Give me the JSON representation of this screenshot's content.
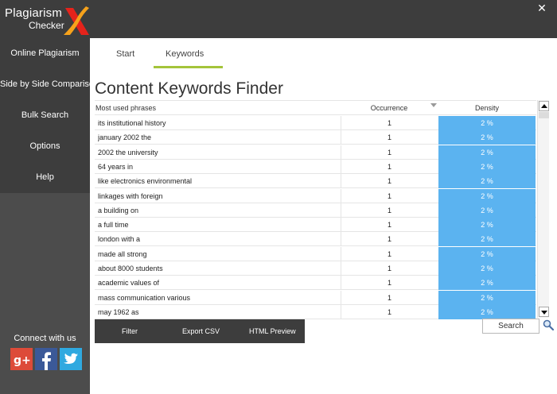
{
  "app": {
    "logo_line1": "Plagiarism",
    "logo_line2": "Checker",
    "close_glyph": "✕"
  },
  "sidebar": {
    "items": [
      {
        "label": "Online Plagiarism"
      },
      {
        "label": "Side by Side Comparison"
      },
      {
        "label": "Bulk Search"
      },
      {
        "label": "Options"
      },
      {
        "label": "Help"
      }
    ],
    "connect_label": "Connect with us",
    "social": [
      {
        "icon": "google-plus-icon",
        "glyph": "g+",
        "color": "#dd4b39"
      },
      {
        "icon": "facebook-icon",
        "glyph": "f",
        "color": "#3b5998"
      },
      {
        "icon": "twitter-icon",
        "glyph": "bird",
        "color": "#2fa9e0"
      }
    ]
  },
  "tabs": [
    {
      "label": "Start",
      "active": false
    },
    {
      "label": "Keywords",
      "active": true
    }
  ],
  "page_title": "Content Keywords Finder",
  "table": {
    "columns": [
      "Most used phrases",
      "Occurrence",
      "Density"
    ],
    "rows": [
      {
        "phrase": "its institutional history",
        "occurrence": "1",
        "density": "2 %"
      },
      {
        "phrase": "january 2002 the",
        "occurrence": "1",
        "density": "2 %"
      },
      {
        "phrase": "2002 the university",
        "occurrence": "1",
        "density": "2 %"
      },
      {
        "phrase": "64 years in",
        "occurrence": "1",
        "density": "2 %"
      },
      {
        "phrase": "like electronics environmental",
        "occurrence": "1",
        "density": "2 %"
      },
      {
        "phrase": "linkages with foreign",
        "occurrence": "1",
        "density": "2 %"
      },
      {
        "phrase": "a building on",
        "occurrence": "1",
        "density": "2 %"
      },
      {
        "phrase": "a full time",
        "occurrence": "1",
        "density": "2 %"
      },
      {
        "phrase": "london with a",
        "occurrence": "1",
        "density": "2 %"
      },
      {
        "phrase": "made all strong",
        "occurrence": "1",
        "density": "2 %"
      },
      {
        "phrase": "about 8000 students",
        "occurrence": "1",
        "density": "2 %"
      },
      {
        "phrase": "academic values of",
        "occurrence": "1",
        "density": "2 %"
      },
      {
        "phrase": "mass communication various",
        "occurrence": "1",
        "density": "2 %"
      },
      {
        "phrase": "may 1962 as",
        "occurrence": "1",
        "density": "2 %"
      }
    ]
  },
  "actions": {
    "filter": "Filter",
    "export_csv": "Export CSV",
    "html_preview": "HTML Preview"
  },
  "search": {
    "button_label": "Search"
  },
  "colors": {
    "accent_underline": "#a4c43a",
    "density_cell": "#5bb3f0",
    "sidebar_dark": "#3d3d3d",
    "sidebar": "#4c4c4c"
  }
}
